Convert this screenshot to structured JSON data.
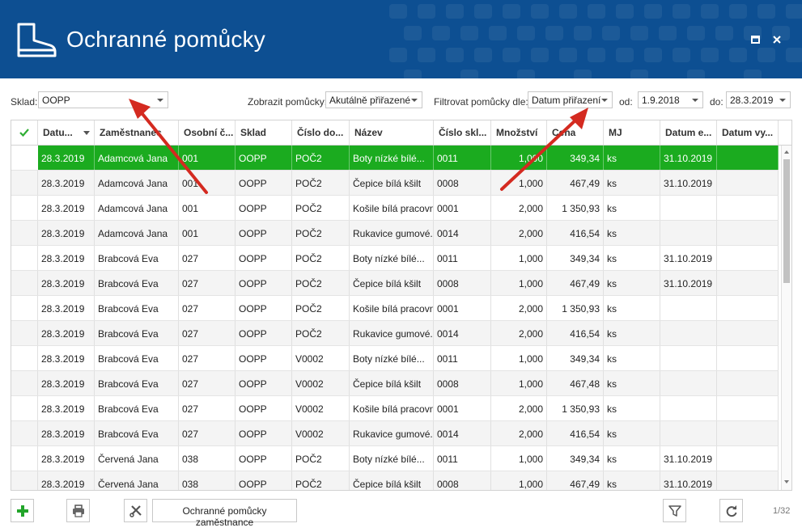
{
  "header": {
    "title": "Ochranné pomůcky",
    "icon": "boot-icon",
    "bg_color": "#0d4f92"
  },
  "filters": {
    "sklad_label": "Sklad:",
    "sklad_value": "OOPP",
    "zobrazit_label": "Zobrazit pomůcky:",
    "zobrazit_value": "Akutálně přiřazené",
    "filtrovat_label": "Filtrovat pomůcky dle:",
    "filtrovat_value": "Datum přiřazení",
    "od_label": "od:",
    "od_value": "1.9.2018",
    "do_label": "do:",
    "do_value": "28.3.2019"
  },
  "grid": {
    "columns": [
      "",
      "Datu...",
      "Zaměstnanec",
      "Osobní č...",
      "Sklad",
      "Číslo do...",
      "Název",
      "Číslo skl...",
      "Množství",
      "Cena",
      "MJ",
      "Datum e...",
      "Datum vy..."
    ],
    "rows": [
      [
        "28.3.2019",
        "Adamcová Jana",
        "001",
        "OOPP",
        "POČ2",
        "Boty nízké bílé...",
        "0011",
        "1,000",
        "349,34",
        "ks",
        "31.10.2019",
        ""
      ],
      [
        "28.3.2019",
        "Adamcová Jana",
        "001",
        "OOPP",
        "POČ2",
        "Čepice bílá kšilt",
        "0008",
        "1,000",
        "467,49",
        "ks",
        "31.10.2019",
        ""
      ],
      [
        "28.3.2019",
        "Adamcová Jana",
        "001",
        "OOPP",
        "POČ2",
        "Košile bílá pracovní",
        "0001",
        "2,000",
        "1 350,93",
        "ks",
        "",
        ""
      ],
      [
        "28.3.2019",
        "Adamcová Jana",
        "001",
        "OOPP",
        "POČ2",
        "Rukavice gumové...",
        "0014",
        "2,000",
        "416,54",
        "ks",
        "",
        ""
      ],
      [
        "28.3.2019",
        "Brabcová Eva",
        "027",
        "OOPP",
        "POČ2",
        "Boty nízké bílé...",
        "0011",
        "1,000",
        "349,34",
        "ks",
        "31.10.2019",
        ""
      ],
      [
        "28.3.2019",
        "Brabcová Eva",
        "027",
        "OOPP",
        "POČ2",
        "Čepice bílá kšilt",
        "0008",
        "1,000",
        "467,49",
        "ks",
        "31.10.2019",
        ""
      ],
      [
        "28.3.2019",
        "Brabcová Eva",
        "027",
        "OOPP",
        "POČ2",
        "Košile bílá pracovní",
        "0001",
        "2,000",
        "1 350,93",
        "ks",
        "",
        ""
      ],
      [
        "28.3.2019",
        "Brabcová Eva",
        "027",
        "OOPP",
        "POČ2",
        "Rukavice gumové...",
        "0014",
        "2,000",
        "416,54",
        "ks",
        "",
        ""
      ],
      [
        "28.3.2019",
        "Brabcová Eva",
        "027",
        "OOPP",
        "V0002",
        "Boty nízké bílé...",
        "0011",
        "1,000",
        "349,34",
        "ks",
        "",
        ""
      ],
      [
        "28.3.2019",
        "Brabcová Eva",
        "027",
        "OOPP",
        "V0002",
        "Čepice bílá kšilt",
        "0008",
        "1,000",
        "467,48",
        "ks",
        "",
        ""
      ],
      [
        "28.3.2019",
        "Brabcová Eva",
        "027",
        "OOPP",
        "V0002",
        "Košile bílá pracovní",
        "0001",
        "2,000",
        "1 350,93",
        "ks",
        "",
        ""
      ],
      [
        "28.3.2019",
        "Brabcová Eva",
        "027",
        "OOPP",
        "V0002",
        "Rukavice gumové...",
        "0014",
        "2,000",
        "416,54",
        "ks",
        "",
        ""
      ],
      [
        "28.3.2019",
        "Červená Jana",
        "038",
        "OOPP",
        "POČ2",
        "Boty nízké bílé...",
        "0011",
        "1,000",
        "349,34",
        "ks",
        "31.10.2019",
        ""
      ],
      [
        "28.3.2019",
        "Červená Jana",
        "038",
        "OOPP",
        "POČ2",
        "Čepice bílá kšilt",
        "0008",
        "1,000",
        "467,49",
        "ks",
        "31.10.2019",
        ""
      ]
    ],
    "selected_row": 0,
    "selected_color": "#1bab1f"
  },
  "toolbar": {
    "add_icon": "plus-icon",
    "print_icon": "printer-icon",
    "tools_icon": "wrench-screwdriver-icon",
    "employee_button_label": "Ochranné pomůcky zaměstnance",
    "filter_icon": "funnel-icon",
    "refresh_icon": "refresh-icon",
    "page_indicator": "1/32"
  },
  "annotations": {
    "arrow_color": "#d42a20"
  }
}
